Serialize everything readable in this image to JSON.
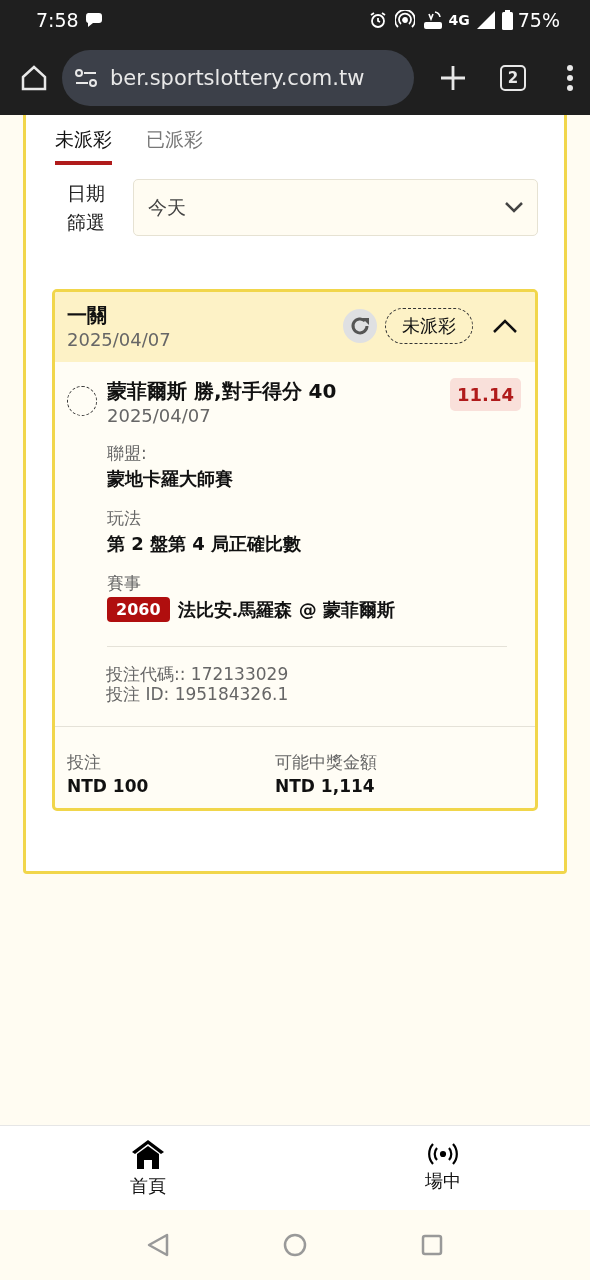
{
  "status_bar": {
    "time": "7:58",
    "network": "4G",
    "battery": "75%"
  },
  "browser": {
    "url": "ber.sportslottery.com.tw",
    "tab_count": "2"
  },
  "tabs": [
    {
      "label": "未派彩",
      "selected": true
    },
    {
      "label": "已派彩",
      "selected": false
    }
  ],
  "date_filter": {
    "label": "日期篩選",
    "value": "今天"
  },
  "bet": {
    "title": "一關",
    "date": "2025/04/07",
    "status": "未派彩",
    "expanded": true,
    "selection": {
      "selected": false,
      "name": "蒙菲爾斯 勝,對手得分 40",
      "date": "2025/04/07",
      "odds": "11.14"
    },
    "details": [
      {
        "label": "聯盟:",
        "value": "蒙地卡羅大師賽"
      },
      {
        "label": "玩法",
        "value": "第 2 盤第 4 局正確比數"
      }
    ],
    "event": {
      "label": "賽事",
      "code": "2060",
      "name": "法比安.馬羅森 @ 蒙菲爾斯"
    },
    "refs": [
      "投注代碼:: 172133029",
      "投注 ID: 195184326.1"
    ],
    "summary": [
      {
        "label": "投注",
        "value": "NTD 100"
      },
      {
        "label": "可能中獎金額",
        "value": "NTD 1,114"
      }
    ]
  },
  "bottom_nav": [
    {
      "kind": "home",
      "label": "首頁"
    },
    {
      "kind": "live",
      "label": "場中"
    }
  ]
}
